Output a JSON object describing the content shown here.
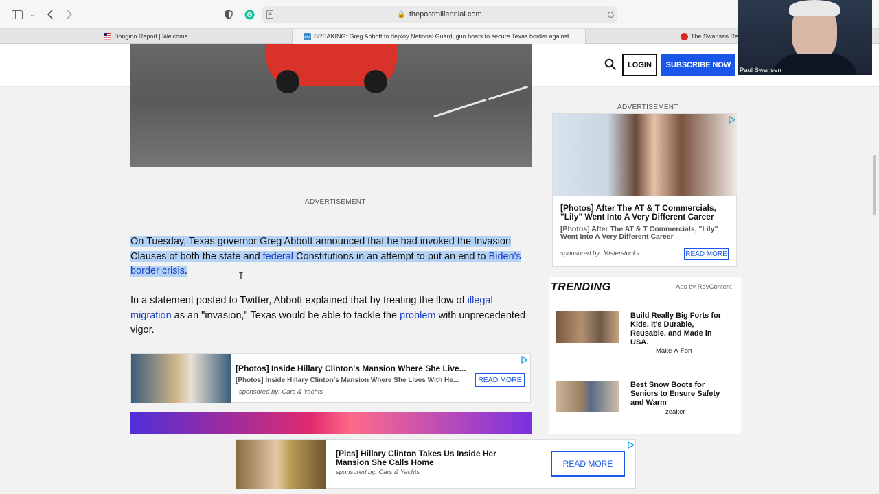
{
  "browser": {
    "url": "thepostmillennial.com",
    "tabs": [
      {
        "label": "Bongino Report | Welcome"
      },
      {
        "label": "BREAKING: Greg Abbott to deploy National Guard, gun boats to secure Texas border against..."
      },
      {
        "label": "The Swansen Re"
      }
    ]
  },
  "header": {
    "login_label": "LOGIN",
    "subscribe_label": "SUBSCRIBE NOW"
  },
  "article": {
    "ad_label": "ADVERTISEMENT",
    "p1_a": "On Tuesday, Texas governor Greg Abbott announced that he had invoked the Invasion Clauses of both the state and ",
    "p1_link1": "federal",
    "p1_b": " Constitutions in an attempt to put an end to ",
    "p1_link2": "Biden's border crisis",
    "p1_c": ".",
    "p2_a": "In a statement posted to Twitter, Abbott explained that by treating the flow of ",
    "p2_link1": "illegal migration",
    "p2_b": " as an \"invasion,\" Texas would be able to tackle the ",
    "p2_link2": "problem",
    "p2_c": " with unprecedented vigor."
  },
  "inline_ad": {
    "title": "[Photos] Inside Hillary Clinton's Mansion Where She Live...",
    "subtitle": "[Photos] Inside Hillary Clinton's Mansion Where She Lives With He...",
    "sponsor": "sponsored by: Cars & Yachts",
    "cta": "READ MORE"
  },
  "sidebar_ad": {
    "label": "ADVERTISEMENT",
    "title": "[Photos] After The AT & T Commercials, \"Lily\" Went Into A Very Different Career",
    "subtitle": "[Photos] After The AT & T Commercials, \"Lily\" Went Into A Very Different Career",
    "sponsor": "sponsored by: Misterstocks",
    "cta": "READ MORE"
  },
  "trending": {
    "heading": "TRENDING",
    "ads_by": "Ads by RevContent",
    "items": [
      {
        "title": "Build Really Big Forts for Kids. It's Durable, Reusable, and Made in USA.",
        "source": "Make-A-Fort"
      },
      {
        "title": "Best Snow Boots for Seniors to Ensure Safety and Warm",
        "source": "zeaker"
      }
    ]
  },
  "bottom_ad": {
    "title": "[Pics] Hillary Clinton Takes Us Inside Her Mansion She Calls Home",
    "sponsor": "sponsored by: Cars & Yachts",
    "cta": "READ MORE"
  },
  "video_overlay": {
    "name": "Paul Swansen"
  },
  "colors": {
    "accent": "#1a56e8",
    "link": "#1a3fc8",
    "selection": "#b4d2f5"
  }
}
